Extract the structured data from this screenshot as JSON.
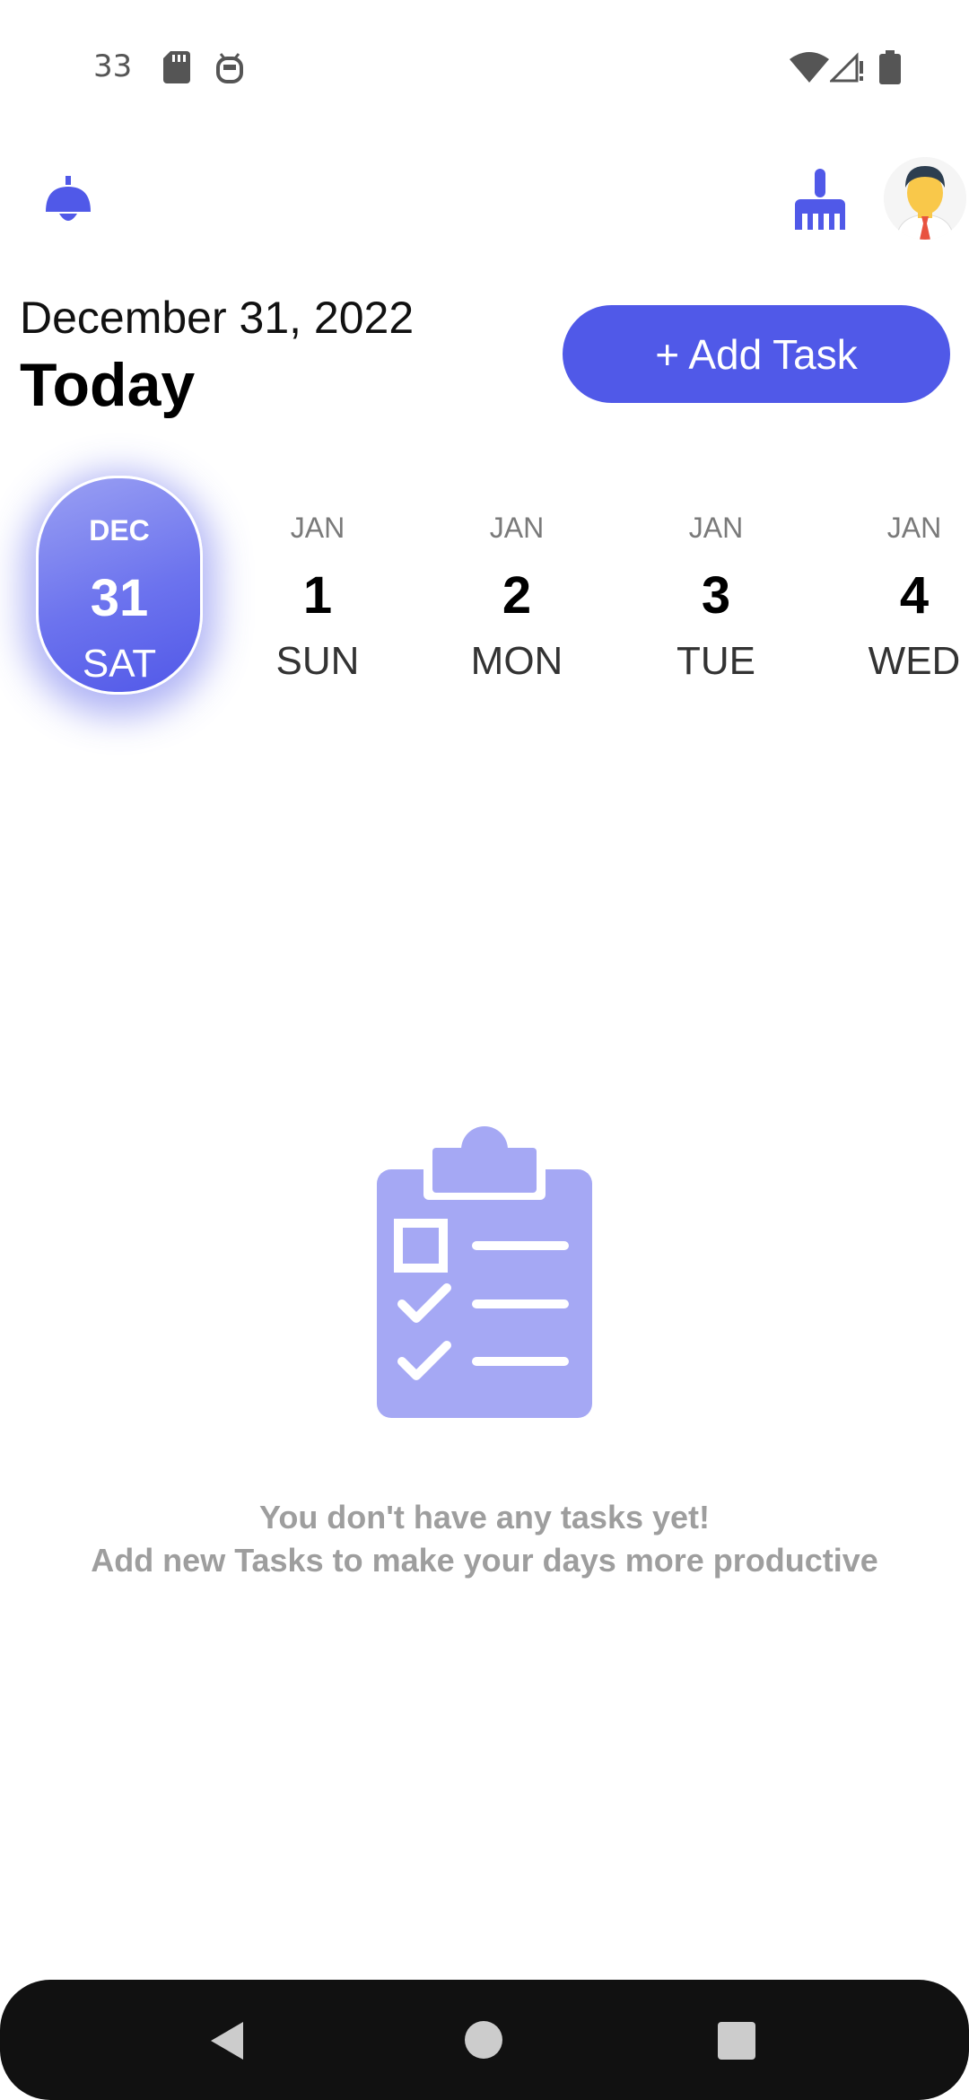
{
  "status_bar": {
    "time": "33",
    "icons": [
      "sd-card-icon",
      "android-debug-icon",
      "wifi-icon",
      "signal-icon",
      "battery-icon"
    ]
  },
  "app_bar": {
    "left_icon": "lamp-icon",
    "right_icons": [
      "broom-icon",
      "avatar"
    ]
  },
  "header": {
    "date": "December 31, 2022",
    "title": "Today",
    "add_button_label": "+ Add Task"
  },
  "date_strip": [
    {
      "month": "DEC",
      "day": "31",
      "weekday": "SAT",
      "selected": true
    },
    {
      "month": "JAN",
      "day": "1",
      "weekday": "SUN",
      "selected": false
    },
    {
      "month": "JAN",
      "day": "2",
      "weekday": "MON",
      "selected": false
    },
    {
      "month": "JAN",
      "day": "3",
      "weekday": "TUE",
      "selected": false
    },
    {
      "month": "JAN",
      "day": "4",
      "weekday": "WED",
      "selected": false
    }
  ],
  "empty_state": {
    "icon": "clipboard-checklist-icon",
    "line1": "You don't have any tasks yet!",
    "line2": "Add new Tasks to make your days more productive"
  },
  "colors": {
    "accent": "#5059e8",
    "illustration": "#a5a8f4",
    "muted_text": "#9e9e9e"
  },
  "nav_bar": {
    "buttons": [
      "back-icon",
      "home-icon",
      "recents-icon"
    ]
  }
}
